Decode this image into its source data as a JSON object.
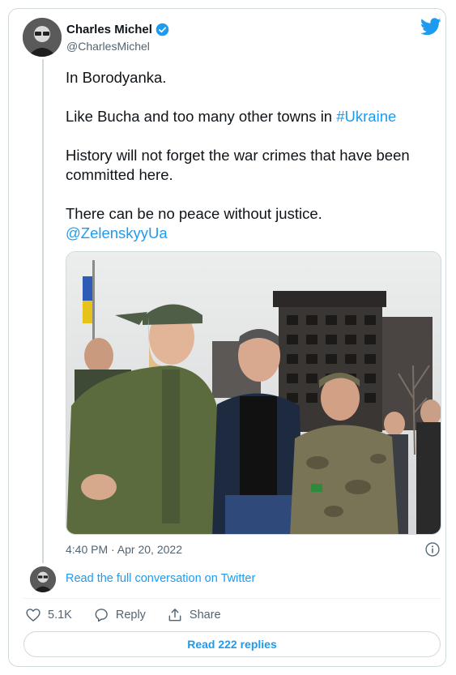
{
  "author": {
    "name": "Charles Michel",
    "handle": "@CharlesMichel"
  },
  "tweet": {
    "paragraphs": [
      {
        "text": "In Borodyanka.",
        "link": ""
      },
      {
        "text": "Like Bucha and too many other towns in ",
        "link": "#Ukraine"
      },
      {
        "text": "History will not forget the war crimes that have been committed here.",
        "link": ""
      },
      {
        "text": "There can be no peace without justice.",
        "link": "@ZelenskyyUa"
      }
    ],
    "timestamp": "4:40 PM · Apr 20, 2022"
  },
  "thread": {
    "read_full_label": "Read the full conversation on Twitter"
  },
  "actions": {
    "likes_count": "5.1K",
    "reply_label": "Reply",
    "share_label": "Share"
  },
  "replies_button": {
    "label": "Read 222 replies"
  },
  "icons": {
    "verified": "verified-badge-icon",
    "brand": "twitter-bird-icon",
    "info": "info-icon",
    "like": "heart-icon",
    "reply": "speech-bubble-icon",
    "share": "upload-arrow-icon"
  },
  "colors": {
    "accent": "#1d9bf0",
    "text": "#0f1419",
    "muted": "#536471",
    "border": "#cfd9de"
  }
}
